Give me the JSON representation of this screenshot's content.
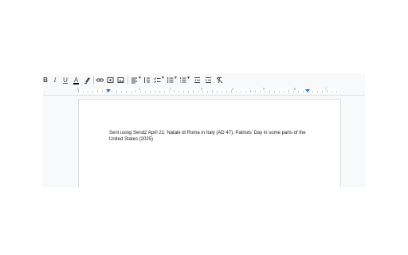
{
  "toolbar": {
    "bold_label": "B",
    "italic_label": "I",
    "underline_label": "U",
    "text_color_label": "A",
    "buttons": [
      {
        "name": "bold-button",
        "icon": "bold-icon"
      },
      {
        "name": "italic-button",
        "icon": "italic-icon"
      },
      {
        "name": "underline-button",
        "icon": "underline-icon"
      },
      {
        "name": "text-color-button",
        "icon": "text-color-icon"
      },
      {
        "name": "highlight-color-button",
        "icon": "highlighter-icon"
      },
      {
        "name": "insert-link-button",
        "icon": "link-icon"
      },
      {
        "name": "insert-comment-button",
        "icon": "comment-icon"
      },
      {
        "name": "insert-image-button",
        "icon": "image-icon"
      },
      {
        "name": "align-button",
        "icon": "align-left-icon"
      },
      {
        "name": "line-spacing-button",
        "icon": "line-spacing-icon"
      },
      {
        "name": "checklist-button",
        "icon": "checklist-icon"
      },
      {
        "name": "bulleted-list-button",
        "icon": "bulleted-list-icon"
      },
      {
        "name": "numbered-list-button",
        "icon": "numbered-list-icon"
      },
      {
        "name": "decrease-indent-button",
        "icon": "indent-decrease-icon"
      },
      {
        "name": "increase-indent-button",
        "icon": "indent-increase-icon"
      },
      {
        "name": "clear-formatting-button",
        "icon": "clear-formatting-icon"
      }
    ]
  },
  "ruler": {
    "numbers": [
      "1",
      "1",
      "2",
      "3",
      "4",
      "5",
      "6",
      "7"
    ],
    "marker_color": "#1a73e8"
  },
  "document": {
    "body_text": "Sent using Send2 April 21: Natale di Roma in Italy (AD 47), Patriots' Day in some parts of the United States (2025)"
  },
  "colors": {
    "toolbar_bg": "#f8f9fa",
    "icon": "#444746",
    "accent": "#1a73e8"
  }
}
